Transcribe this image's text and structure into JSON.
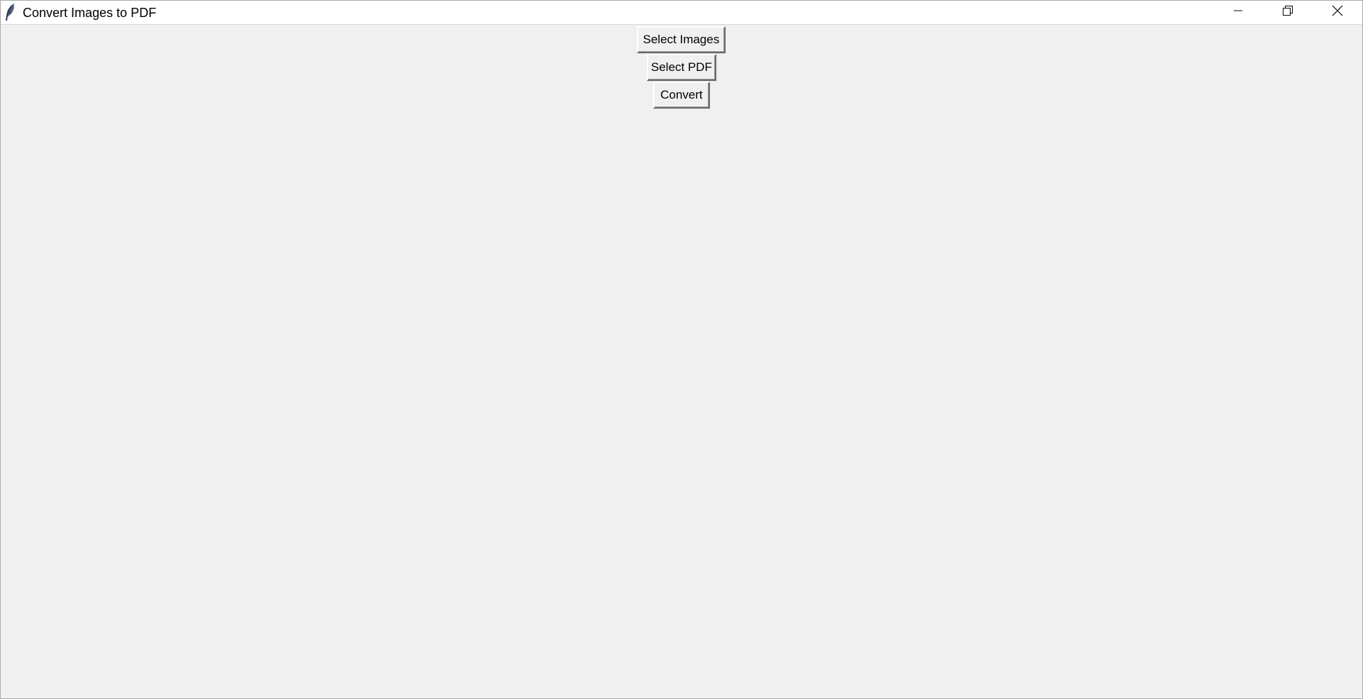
{
  "window": {
    "title": "Convert Images to PDF",
    "app_icon": "feather-icon",
    "controls": {
      "minimize_icon": "minimize-icon",
      "maximize_icon": "restore-icon",
      "close_icon": "close-icon"
    }
  },
  "main": {
    "buttons": {
      "select_images_label": "Select Images",
      "select_pdf_label": "Select PDF",
      "convert_label": "Convert"
    }
  },
  "colors": {
    "background": "#f0f0f0",
    "titlebar": "#ffffff"
  }
}
